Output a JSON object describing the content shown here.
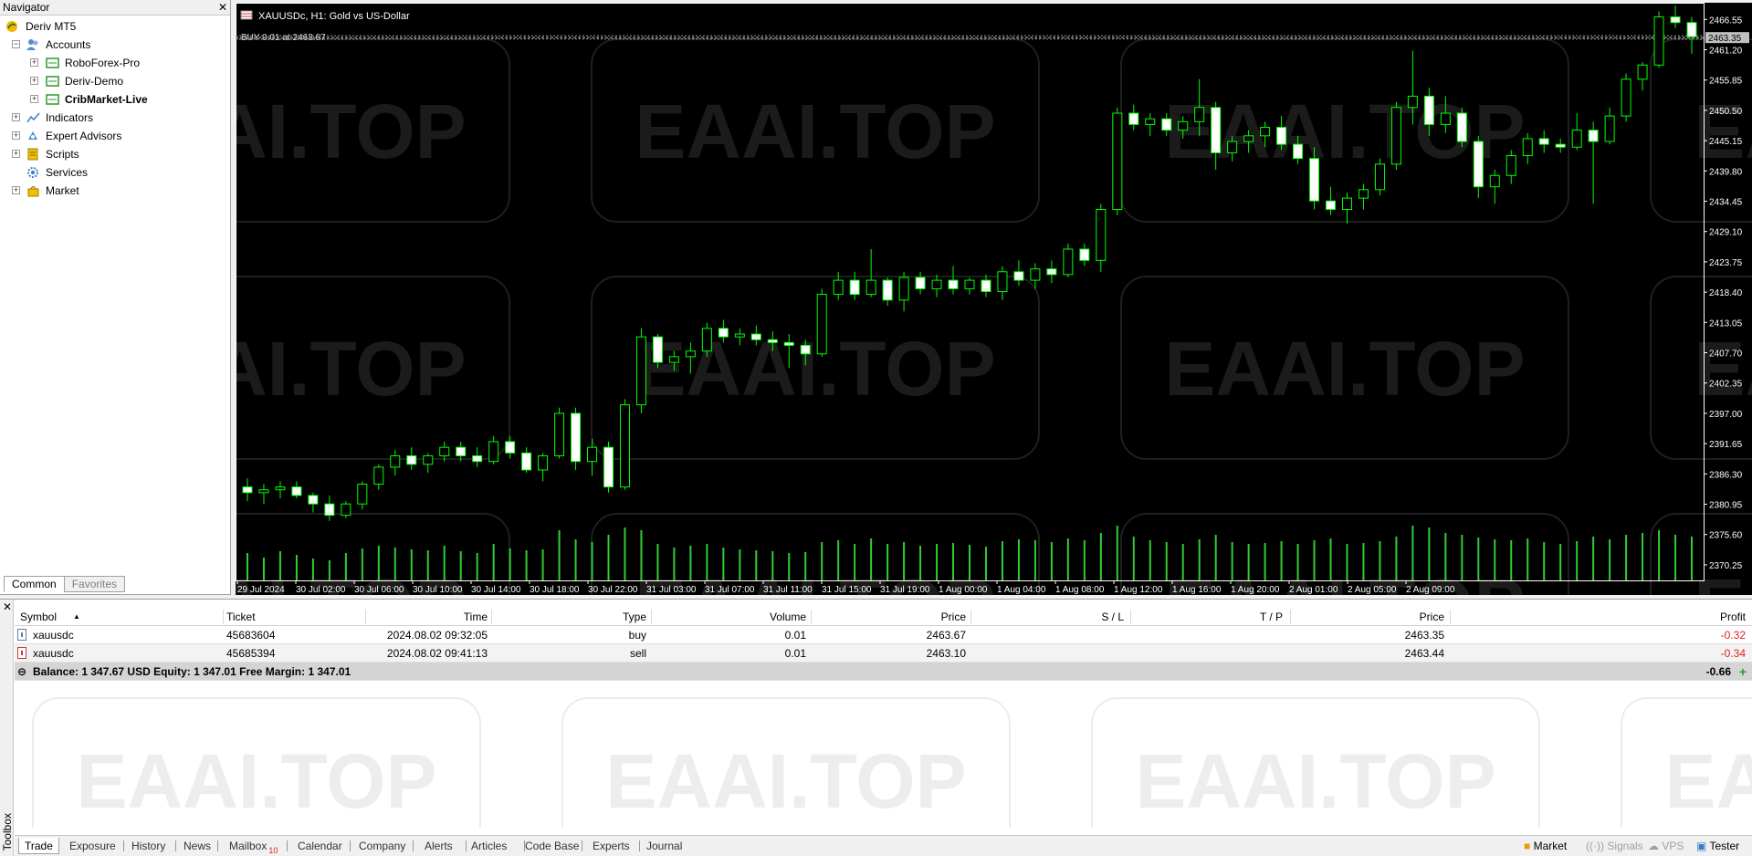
{
  "navigator": {
    "title": "Navigator",
    "root": "Deriv MT5",
    "accounts_label": "Accounts",
    "accounts": [
      "RoboForex-Pro",
      "Deriv-Demo",
      "CribMarket-Live"
    ],
    "items": [
      "Indicators",
      "Expert Advisors",
      "Scripts",
      "Services",
      "Market"
    ],
    "tabs": [
      "Common",
      "Favorites"
    ]
  },
  "chart": {
    "title": "XAUUSDc, H1:  Gold vs US-Dollar",
    "trade_label": "BUY 0.01 at 2463.67",
    "current_price": "2463.35",
    "price_ticks": [
      "2466.55",
      "2461.20",
      "2455.85",
      "2450.50",
      "2445.15",
      "2439.80",
      "2434.45",
      "2429.10",
      "2423.75",
      "2418.40",
      "2413.05",
      "2407.70",
      "2402.35",
      "2397.00",
      "2391.65",
      "2386.30",
      "2380.95",
      "2375.60",
      "2370.25"
    ],
    "time_ticks": [
      "29 Jul 2024",
      "30 Jul 02:00",
      "30 Jul 06:00",
      "30 Jul 10:00",
      "30 Jul 14:00",
      "30 Jul 18:00",
      "30 Jul 22:00",
      "31 Jul 03:00",
      "31 Jul 07:00",
      "31 Jul 11:00",
      "31 Jul 15:00",
      "31 Jul 19:00",
      "1 Aug 00:00",
      "1 Aug 04:00",
      "1 Aug 08:00",
      "1 Aug 12:00",
      "1 Aug 16:00",
      "1 Aug 20:00",
      "2 Aug 01:00",
      "2 Aug 05:00",
      "2 Aug 09:00"
    ],
    "watermark": "EAAI.TOP",
    "colors": {
      "background": "#000000",
      "bull": "#00ff00",
      "bear_body": "#ffffff",
      "volume": "#32cd32",
      "axis_text": "#ffffff"
    }
  },
  "chart_data": {
    "type": "candlestick",
    "symbol": "XAUUSDc",
    "timeframe": "H1",
    "ylim": [
      2367.5,
      2469.5
    ],
    "candles": [
      [
        2384.0,
        2385.5,
        2381.5,
        2383.0
      ],
      [
        2383.0,
        2384.5,
        2381.0,
        2383.5
      ],
      [
        2383.5,
        2385.0,
        2382.0,
        2384.0
      ],
      [
        2384.0,
        2385.0,
        2382.0,
        2382.5
      ],
      [
        2382.5,
        2383.0,
        2379.5,
        2381.0
      ],
      [
        2381.0,
        2382.5,
        2378.0,
        2379.0
      ],
      [
        2379.0,
        2381.5,
        2378.5,
        2381.0
      ],
      [
        2381.0,
        2385.0,
        2380.0,
        2384.5
      ],
      [
        2384.5,
        2388.0,
        2383.5,
        2387.5
      ],
      [
        2387.5,
        2390.5,
        2386.0,
        2389.5
      ],
      [
        2389.5,
        2391.0,
        2387.0,
        2388.0
      ],
      [
        2388.0,
        2390.0,
        2386.5,
        2389.5
      ],
      [
        2389.5,
        2392.0,
        2388.5,
        2391.0
      ],
      [
        2391.0,
        2392.0,
        2388.5,
        2389.5
      ],
      [
        2389.5,
        2391.0,
        2387.5,
        2388.5
      ],
      [
        2388.5,
        2393.0,
        2388.0,
        2392.0
      ],
      [
        2392.0,
        2393.0,
        2389.0,
        2390.0
      ],
      [
        2390.0,
        2391.0,
        2386.5,
        2387.0
      ],
      [
        2387.0,
        2390.0,
        2385.0,
        2389.5
      ],
      [
        2389.5,
        2398.0,
        2389.0,
        2397.0
      ],
      [
        2397.0,
        2398.0,
        2387.0,
        2388.5
      ],
      [
        2388.5,
        2392.5,
        2386.0,
        2391.0
      ],
      [
        2391.0,
        2392.0,
        2383.0,
        2384.0
      ],
      [
        2384.0,
        2399.5,
        2383.5,
        2398.5
      ],
      [
        2398.5,
        2412.0,
        2397.0,
        2410.5
      ],
      [
        2410.5,
        2411.0,
        2405.0,
        2406.0
      ],
      [
        2406.0,
        2408.0,
        2404.5,
        2407.0
      ],
      [
        2407.0,
        2409.5,
        2404.0,
        2408.0
      ],
      [
        2408.0,
        2413.0,
        2407.0,
        2412.0
      ],
      [
        2412.0,
        2413.5,
        2409.5,
        2410.5
      ],
      [
        2410.5,
        2412.0,
        2409.0,
        2411.0
      ],
      [
        2411.0,
        2412.5,
        2409.0,
        2410.0
      ],
      [
        2410.0,
        2411.5,
        2408.0,
        2409.5
      ],
      [
        2409.5,
        2411.0,
        2405.0,
        2409.0
      ],
      [
        2409.0,
        2410.0,
        2405.5,
        2407.5
      ],
      [
        2407.5,
        2419.0,
        2407.0,
        2418.0
      ],
      [
        2418.0,
        2422.0,
        2417.0,
        2420.5
      ],
      [
        2420.5,
        2422.0,
        2417.0,
        2418.0
      ],
      [
        2418.0,
        2426.0,
        2417.5,
        2420.5
      ],
      [
        2420.5,
        2421.0,
        2416.0,
        2417.0
      ],
      [
        2417.0,
        2422.0,
        2415.0,
        2421.0
      ],
      [
        2421.0,
        2422.0,
        2418.0,
        2419.0
      ],
      [
        2419.0,
        2421.5,
        2417.5,
        2420.5
      ],
      [
        2420.5,
        2423.0,
        2418.0,
        2419.0
      ],
      [
        2419.0,
        2421.0,
        2418.0,
        2420.5
      ],
      [
        2420.5,
        2421.5,
        2417.5,
        2418.5
      ],
      [
        2418.5,
        2423.0,
        2417.0,
        2422.0
      ],
      [
        2422.0,
        2424.0,
        2419.5,
        2420.5
      ],
      [
        2420.5,
        2423.5,
        2419.0,
        2422.5
      ],
      [
        2422.5,
        2424.0,
        2420.0,
        2421.5
      ],
      [
        2421.5,
        2427.0,
        2421.0,
        2426.0
      ],
      [
        2426.0,
        2427.0,
        2423.0,
        2424.0
      ],
      [
        2424.0,
        2434.0,
        2422.0,
        2433.0
      ],
      [
        2433.0,
        2451.0,
        2432.0,
        2450.0
      ],
      [
        2450.0,
        2451.5,
        2447.0,
        2448.0
      ],
      [
        2448.0,
        2450.0,
        2446.0,
        2449.0
      ],
      [
        2449.0,
        2450.0,
        2446.0,
        2447.0
      ],
      [
        2447.0,
        2449.5,
        2445.5,
        2448.5
      ],
      [
        2448.5,
        2456.0,
        2446.0,
        2451.0
      ],
      [
        2451.0,
        2452.0,
        2440.0,
        2443.0
      ],
      [
        2443.0,
        2446.0,
        2441.5,
        2445.0
      ],
      [
        2445.0,
        2447.0,
        2443.0,
        2446.0
      ],
      [
        2446.0,
        2448.5,
        2444.0,
        2447.5
      ],
      [
        2447.5,
        2449.5,
        2443.5,
        2444.5
      ],
      [
        2444.5,
        2446.0,
        2441.0,
        2442.0
      ],
      [
        2442.0,
        2444.0,
        2433.0,
        2434.5
      ],
      [
        2434.5,
        2437.0,
        2432.0,
        2433.0
      ],
      [
        2433.0,
        2436.0,
        2430.5,
        2435.0
      ],
      [
        2435.0,
        2437.5,
        2433.0,
        2436.5
      ],
      [
        2436.5,
        2442.0,
        2435.5,
        2441.0
      ],
      [
        2441.0,
        2452.0,
        2440.0,
        2451.0
      ],
      [
        2451.0,
        2461.0,
        2448.0,
        2453.0
      ],
      [
        2453.0,
        2454.5,
        2446.0,
        2448.0
      ],
      [
        2448.0,
        2453.0,
        2446.5,
        2450.0
      ],
      [
        2450.0,
        2451.0,
        2444.0,
        2445.0
      ],
      [
        2445.0,
        2446.0,
        2435.0,
        2437.0
      ],
      [
        2437.0,
        2440.0,
        2434.0,
        2439.0
      ],
      [
        2439.0,
        2443.5,
        2437.5,
        2442.5
      ],
      [
        2442.5,
        2446.5,
        2441.0,
        2445.5
      ],
      [
        2445.5,
        2447.0,
        2443.0,
        2444.5
      ],
      [
        2444.5,
        2445.5,
        2443.0,
        2444.0
      ],
      [
        2444.0,
        2450.0,
        2443.5,
        2447.0
      ],
      [
        2447.0,
        2448.5,
        2434.0,
        2445.0
      ],
      [
        2445.0,
        2451.0,
        2444.5,
        2449.5
      ],
      [
        2449.5,
        2457.0,
        2448.5,
        2456.0
      ],
      [
        2456.0,
        2459.0,
        2454.0,
        2458.5
      ],
      [
        2458.5,
        2468.0,
        2458.0,
        2467.0
      ],
      [
        2467.0,
        2469.0,
        2465.0,
        2466.0
      ],
      [
        2466.0,
        2467.0,
        2460.5,
        2463.5
      ]
    ],
    "volumes": [
      30,
      25,
      32,
      28,
      24,
      22,
      30,
      35,
      38,
      36,
      34,
      33,
      38,
      32,
      30,
      40,
      35,
      33,
      34,
      55,
      45,
      42,
      50,
      58,
      55,
      40,
      36,
      38,
      40,
      36,
      34,
      33,
      32,
      30,
      31,
      42,
      44,
      40,
      46,
      40,
      42,
      38,
      40,
      41,
      39,
      37,
      43,
      45,
      44,
      42,
      46,
      44,
      52,
      60,
      48,
      44,
      42,
      40,
      45,
      50,
      42,
      40,
      41,
      43,
      40,
      44,
      46,
      40,
      41,
      43,
      48,
      60,
      58,
      52,
      50,
      47,
      45,
      44,
      46,
      42,
      40,
      43,
      48,
      45,
      50,
      52,
      55,
      50,
      48
    ],
    "positions": [
      {
        "type": "buy",
        "price": 2463.67
      },
      {
        "type": "sell",
        "price": 2463.1
      }
    ]
  },
  "toolbox": {
    "label": "Toolbox",
    "columns": [
      "Symbol",
      "Ticket",
      "Time",
      "Type",
      "Volume",
      "Price",
      "S / L",
      "T / P",
      "Price",
      "Profit"
    ],
    "rows": [
      {
        "symbol": "xauusdc",
        "ticket": "45683604",
        "time": "2024.08.02 09:32:05",
        "type": "buy",
        "volume": "0.01",
        "price": "2463.67",
        "sl": "",
        "tp": "",
        "cur": "2463.35",
        "profit": "-0.32"
      },
      {
        "symbol": "xauusdc",
        "ticket": "45685394",
        "time": "2024.08.02 09:41:13",
        "type": "sell",
        "volume": "0.01",
        "price": "2463.10",
        "sl": "",
        "tp": "",
        "cur": "2463.44",
        "profit": "-0.34"
      }
    ],
    "balance_text": "Balance: 1 347.67 USD  Equity: 1 347.01  Free Margin: 1 347.01",
    "total_profit": "-0.66",
    "tabs": [
      "Trade",
      "Exposure",
      "History",
      "News",
      "Mailbox",
      "Calendar",
      "Company",
      "Alerts",
      "Articles",
      "Code Base",
      "Experts",
      "Journal"
    ],
    "mailbox_count": "10",
    "right_tools": [
      "Market",
      "Signals",
      "VPS",
      "Tester"
    ]
  }
}
